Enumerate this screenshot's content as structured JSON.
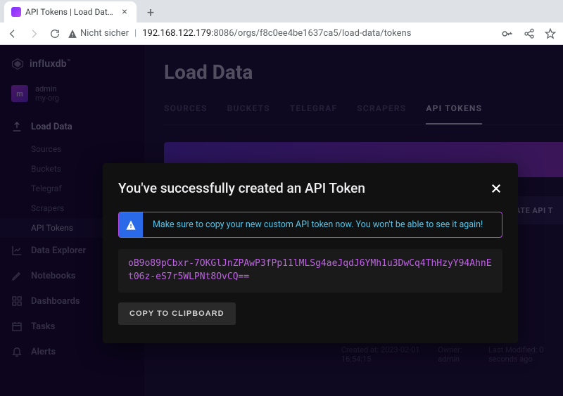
{
  "browser": {
    "tab_title": "API Tokens | Load Data | my",
    "insecure_label": "Nicht sicher",
    "url_host": "192.168.122.179",
    "url_rest": ":8086/orgs/f8c0ee4be1637ca5/load-data/tokens"
  },
  "brand": {
    "name": "influxdb"
  },
  "user": {
    "initial": "m",
    "name": "admin",
    "org": "my-org"
  },
  "sidebar": {
    "items": [
      {
        "label": "Load Data",
        "active": true,
        "sub": [
          {
            "label": "Sources"
          },
          {
            "label": "Buckets"
          },
          {
            "label": "Telegraf"
          },
          {
            "label": "Scrapers"
          },
          {
            "label": "API Tokens",
            "active": true
          }
        ]
      },
      {
        "label": "Data Explorer"
      },
      {
        "label": "Notebooks"
      },
      {
        "label": "Dashboards"
      },
      {
        "label": "Tasks"
      },
      {
        "label": "Alerts"
      }
    ]
  },
  "page": {
    "title": "Load Data",
    "tabs": [
      "SOURCES",
      "BUCKETS",
      "TELEGRAF",
      "SCRAPERS",
      "API TOKENS"
    ],
    "active_tab": 4,
    "create_button": "ATE API T",
    "meta": {
      "created": "Created at: 2023-02-01 16:54:15",
      "owner": "Owner: admin",
      "modified": "Last Modified: 0 seconds ago"
    }
  },
  "modal": {
    "title": "You've successfully created an API Token",
    "alert": "Make sure to copy your new custom API token now. You won't be able to see it again!",
    "token": "oB9o89pCbxr-7OKGlJnZPAwP3fPp11lMLSg4aeJqdJ6YMh1u3DwCq4ThHzyY94AhnEt06z-eS7r5WLPNt8OvCQ==",
    "copy_label": "COPY TO CLIPBOARD"
  }
}
